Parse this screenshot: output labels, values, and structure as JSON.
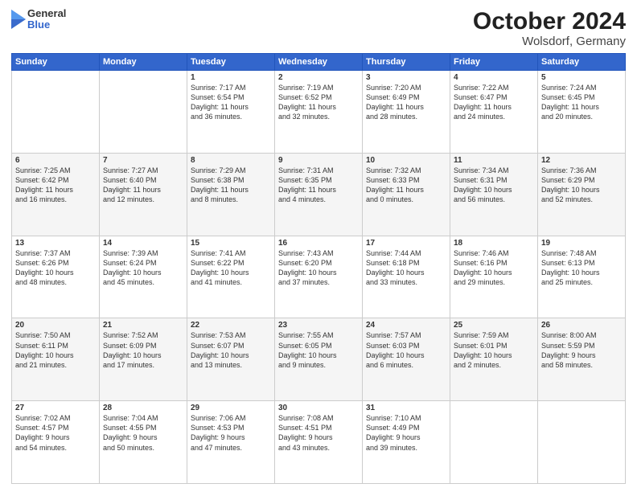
{
  "header": {
    "title": "October 2024",
    "subtitle": "Wolsdorf, Germany",
    "logo_general": "General",
    "logo_blue": "Blue"
  },
  "weekdays": [
    "Sunday",
    "Monday",
    "Tuesday",
    "Wednesday",
    "Thursday",
    "Friday",
    "Saturday"
  ],
  "weeks": [
    [
      {
        "day": "",
        "info": ""
      },
      {
        "day": "",
        "info": ""
      },
      {
        "day": "1",
        "info": "Sunrise: 7:17 AM\nSunset: 6:54 PM\nDaylight: 11 hours\nand 36 minutes."
      },
      {
        "day": "2",
        "info": "Sunrise: 7:19 AM\nSunset: 6:52 PM\nDaylight: 11 hours\nand 32 minutes."
      },
      {
        "day": "3",
        "info": "Sunrise: 7:20 AM\nSunset: 6:49 PM\nDaylight: 11 hours\nand 28 minutes."
      },
      {
        "day": "4",
        "info": "Sunrise: 7:22 AM\nSunset: 6:47 PM\nDaylight: 11 hours\nand 24 minutes."
      },
      {
        "day": "5",
        "info": "Sunrise: 7:24 AM\nSunset: 6:45 PM\nDaylight: 11 hours\nand 20 minutes."
      }
    ],
    [
      {
        "day": "6",
        "info": "Sunrise: 7:25 AM\nSunset: 6:42 PM\nDaylight: 11 hours\nand 16 minutes."
      },
      {
        "day": "7",
        "info": "Sunrise: 7:27 AM\nSunset: 6:40 PM\nDaylight: 11 hours\nand 12 minutes."
      },
      {
        "day": "8",
        "info": "Sunrise: 7:29 AM\nSunset: 6:38 PM\nDaylight: 11 hours\nand 8 minutes."
      },
      {
        "day": "9",
        "info": "Sunrise: 7:31 AM\nSunset: 6:35 PM\nDaylight: 11 hours\nand 4 minutes."
      },
      {
        "day": "10",
        "info": "Sunrise: 7:32 AM\nSunset: 6:33 PM\nDaylight: 11 hours\nand 0 minutes."
      },
      {
        "day": "11",
        "info": "Sunrise: 7:34 AM\nSunset: 6:31 PM\nDaylight: 10 hours\nand 56 minutes."
      },
      {
        "day": "12",
        "info": "Sunrise: 7:36 AM\nSunset: 6:29 PM\nDaylight: 10 hours\nand 52 minutes."
      }
    ],
    [
      {
        "day": "13",
        "info": "Sunrise: 7:37 AM\nSunset: 6:26 PM\nDaylight: 10 hours\nand 48 minutes."
      },
      {
        "day": "14",
        "info": "Sunrise: 7:39 AM\nSunset: 6:24 PM\nDaylight: 10 hours\nand 45 minutes."
      },
      {
        "day": "15",
        "info": "Sunrise: 7:41 AM\nSunset: 6:22 PM\nDaylight: 10 hours\nand 41 minutes."
      },
      {
        "day": "16",
        "info": "Sunrise: 7:43 AM\nSunset: 6:20 PM\nDaylight: 10 hours\nand 37 minutes."
      },
      {
        "day": "17",
        "info": "Sunrise: 7:44 AM\nSunset: 6:18 PM\nDaylight: 10 hours\nand 33 minutes."
      },
      {
        "day": "18",
        "info": "Sunrise: 7:46 AM\nSunset: 6:16 PM\nDaylight: 10 hours\nand 29 minutes."
      },
      {
        "day": "19",
        "info": "Sunrise: 7:48 AM\nSunset: 6:13 PM\nDaylight: 10 hours\nand 25 minutes."
      }
    ],
    [
      {
        "day": "20",
        "info": "Sunrise: 7:50 AM\nSunset: 6:11 PM\nDaylight: 10 hours\nand 21 minutes."
      },
      {
        "day": "21",
        "info": "Sunrise: 7:52 AM\nSunset: 6:09 PM\nDaylight: 10 hours\nand 17 minutes."
      },
      {
        "day": "22",
        "info": "Sunrise: 7:53 AM\nSunset: 6:07 PM\nDaylight: 10 hours\nand 13 minutes."
      },
      {
        "day": "23",
        "info": "Sunrise: 7:55 AM\nSunset: 6:05 PM\nDaylight: 10 hours\nand 9 minutes."
      },
      {
        "day": "24",
        "info": "Sunrise: 7:57 AM\nSunset: 6:03 PM\nDaylight: 10 hours\nand 6 minutes."
      },
      {
        "day": "25",
        "info": "Sunrise: 7:59 AM\nSunset: 6:01 PM\nDaylight: 10 hours\nand 2 minutes."
      },
      {
        "day": "26",
        "info": "Sunrise: 8:00 AM\nSunset: 5:59 PM\nDaylight: 9 hours\nand 58 minutes."
      }
    ],
    [
      {
        "day": "27",
        "info": "Sunrise: 7:02 AM\nSunset: 4:57 PM\nDaylight: 9 hours\nand 54 minutes."
      },
      {
        "day": "28",
        "info": "Sunrise: 7:04 AM\nSunset: 4:55 PM\nDaylight: 9 hours\nand 50 minutes."
      },
      {
        "day": "29",
        "info": "Sunrise: 7:06 AM\nSunset: 4:53 PM\nDaylight: 9 hours\nand 47 minutes."
      },
      {
        "day": "30",
        "info": "Sunrise: 7:08 AM\nSunset: 4:51 PM\nDaylight: 9 hours\nand 43 minutes."
      },
      {
        "day": "31",
        "info": "Sunrise: 7:10 AM\nSunset: 4:49 PM\nDaylight: 9 hours\nand 39 minutes."
      },
      {
        "day": "",
        "info": ""
      },
      {
        "day": "",
        "info": ""
      }
    ]
  ]
}
